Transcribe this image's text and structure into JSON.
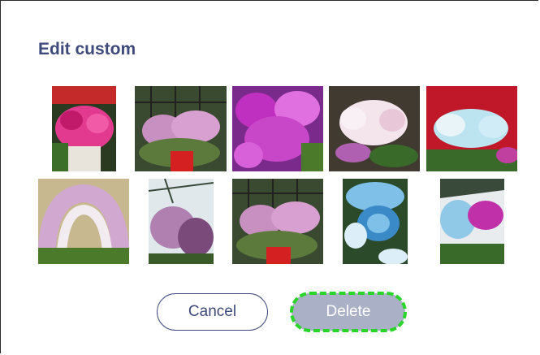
{
  "dialog": {
    "title": "Edit custom"
  },
  "images": [
    {
      "name": "photo-1",
      "subject": "pink orchids in white pot",
      "palette": [
        "#e23a8e",
        "#c21a6a",
        "#3c6e2a",
        "#e8e4dc"
      ]
    },
    {
      "name": "photo-2",
      "subject": "lilac orchids with red pot in greenhouse",
      "palette": [
        "#c890c0",
        "#5c7a3c",
        "#d42020",
        "#2a2a2a"
      ]
    },
    {
      "name": "photo-3",
      "subject": "magenta orchids",
      "palette": [
        "#c030c0",
        "#e070e0",
        "#4a7a2a",
        "#7a2a8a"
      ]
    },
    {
      "name": "photo-4",
      "subject": "white and pink orchids",
      "palette": [
        "#f4e4ec",
        "#b060b0",
        "#3a6a2a",
        "#403a30"
      ]
    },
    {
      "name": "photo-5",
      "subject": "light blue orchids with red background",
      "palette": [
        "#c01828",
        "#bce4f0",
        "#e8f4f8",
        "#3a6a2a"
      ]
    },
    {
      "name": "photo-6",
      "subject": "spotted orchids arch",
      "palette": [
        "#d0a8d0",
        "#f2ecf0",
        "#4a7a2a",
        "#c8b890"
      ]
    },
    {
      "name": "photo-7",
      "subject": "spotted purple orchids under roof",
      "palette": [
        "#b080b0",
        "#7a4a7a",
        "#e0e8ec",
        "#3a5a2a"
      ]
    },
    {
      "name": "photo-8",
      "subject": "lilac orchids with red pot",
      "palette": [
        "#c890c0",
        "#5c7a3c",
        "#d42020",
        "#2a2a2a"
      ]
    },
    {
      "name": "photo-9",
      "subject": "light blue orchids close-up",
      "palette": [
        "#7ec0e8",
        "#3a8ac8",
        "#dceef8",
        "#2a4a2a"
      ]
    },
    {
      "name": "photo-10",
      "subject": "blue and magenta orchids",
      "palette": [
        "#90c8e8",
        "#c030a8",
        "#3a6a2a",
        "#e8ecef"
      ]
    }
  ],
  "buttons": {
    "cancel_label": "Cancel",
    "delete_label": "Delete"
  },
  "colors": {
    "title": "#3d4a7a",
    "cancel_border": "#3d4a7a",
    "delete_bg": "#aab1c6",
    "focus_outline": "#2ad42a"
  }
}
